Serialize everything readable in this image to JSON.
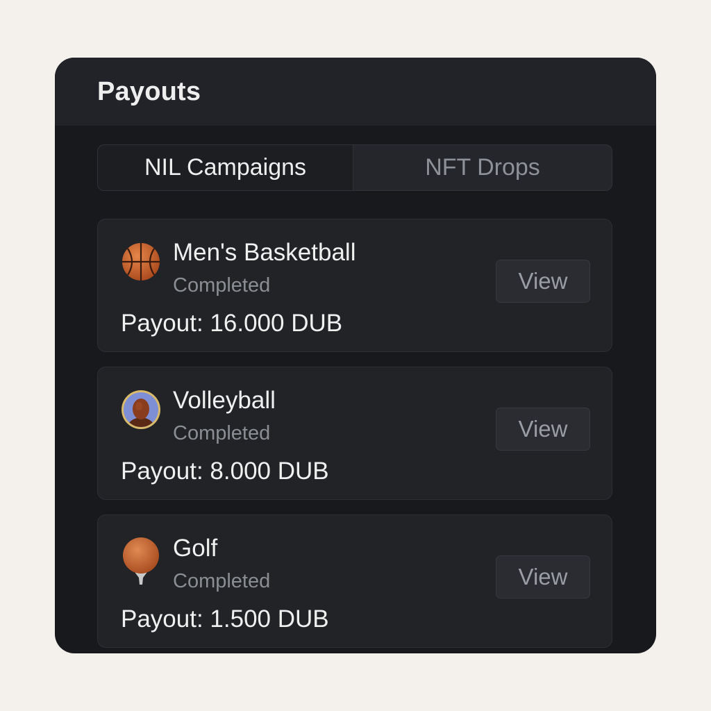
{
  "header": {
    "title": "Payouts"
  },
  "tabs": [
    {
      "label": "NIL Campaigns",
      "active": true
    },
    {
      "label": "NFT Drops",
      "active": false
    }
  ],
  "payouts": [
    {
      "name": "Men's Basketball",
      "status": "Completed",
      "payout": "Payout: 16.000 DUB",
      "action": "View",
      "icon": "basketball-icon"
    },
    {
      "name": "Volleyball",
      "status": "Completed",
      "payout": "Payout: 8.000 DUB",
      "action": "View",
      "icon": "athlete-avatar-icon"
    },
    {
      "name": "Golf",
      "status": "Completed",
      "payout": "Payout: 1.500 DUB",
      "action": "View",
      "icon": "golf-ball-on-tee-icon"
    }
  ],
  "colors": {
    "background": "#f4f1ec",
    "panel": "#17191c",
    "card": "#212327",
    "accent_orange": "#c9652c"
  }
}
